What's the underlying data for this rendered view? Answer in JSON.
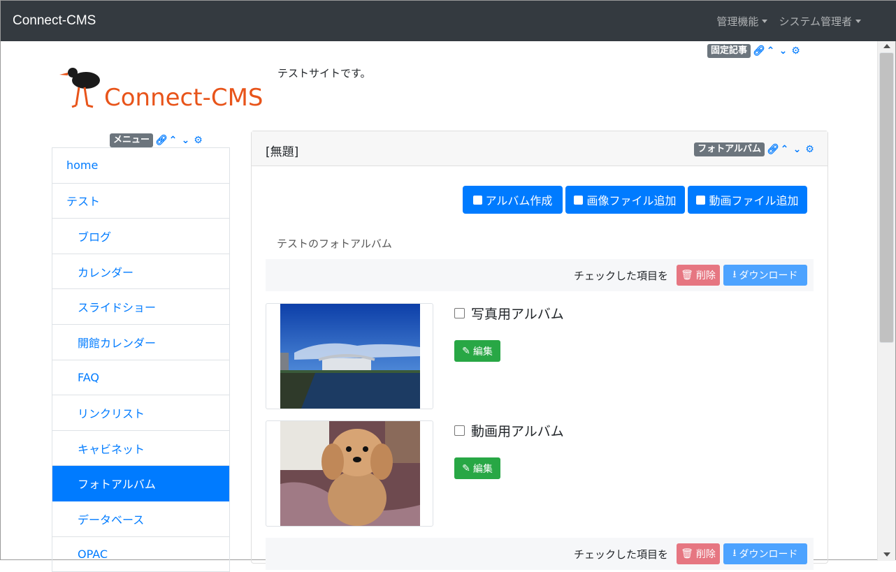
{
  "navbar": {
    "brand": "Connect-CMS",
    "admin_menu": "管理機能",
    "user_menu": "システム管理者"
  },
  "header_frame": {
    "badge": "固定記事"
  },
  "site": {
    "logo_text": "Connect-CMS",
    "description": "テストサイトです。"
  },
  "menu_frame": {
    "badge": "メニュー"
  },
  "menu": {
    "items": [
      {
        "label": "home"
      },
      {
        "label": "テスト"
      },
      {
        "label": "ブログ"
      },
      {
        "label": "カレンダー"
      },
      {
        "label": "スライドショー"
      },
      {
        "label": "開館カレンダー"
      },
      {
        "label": "FAQ"
      },
      {
        "label": "リンクリスト"
      },
      {
        "label": "キャビネット"
      },
      {
        "label": "フォトアルバム"
      },
      {
        "label": "データベース"
      },
      {
        "label": "OPAC"
      }
    ],
    "active": "フォトアルバム"
  },
  "album_frame": {
    "title": "[無題]",
    "badge": "フォトアルバム",
    "buttons": {
      "create_album": "アルバム作成",
      "add_image": "画像ファイル追加",
      "add_video": "動画ファイル追加"
    },
    "description": "テストのフォトアルバム",
    "bulk": {
      "label": "チェックした項目を",
      "delete": "削除",
      "download": "ダウンロード"
    },
    "albums": [
      {
        "name": "写真用アルバム",
        "edit": "編集"
      },
      {
        "name": "動画用アルバム",
        "edit": "編集"
      }
    ]
  },
  "colors": {
    "primary": "#007bff",
    "navbar": "#343a40",
    "success": "#28a745",
    "danger": "#e4606d"
  }
}
